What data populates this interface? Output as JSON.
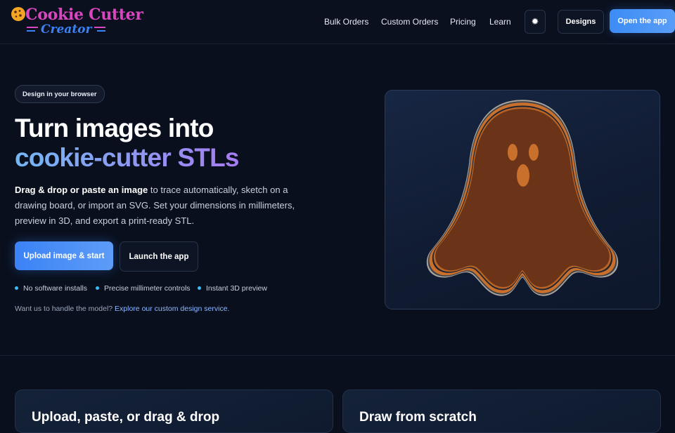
{
  "brand": {
    "line1": "Cookie Cutter",
    "line2": "Creator"
  },
  "nav": {
    "links": [
      "Bulk Orders",
      "Custom Orders",
      "Pricing",
      "Learn"
    ],
    "designs_label": "Designs",
    "open_app_label": "Open the app"
  },
  "hero": {
    "badge": "Design in your browser",
    "title_line1": "Turn images into",
    "title_line2": "cookie-cutter STLs",
    "lead_bold": "Drag & drop or paste an image",
    "lead_rest": " to trace automatically, sketch on a drawing board, or import an SVG. Set your dimensions in millimeters, preview in 3D, and export a print-ready STL.",
    "upload_label": "Upload image & start",
    "launch_label": "Launch the app",
    "features": [
      "No software installs",
      "Precise millimeter controls",
      "Instant 3D preview"
    ],
    "service_prefix": "Want us to handle the model? ",
    "service_link": "Explore our custom design service."
  },
  "cards": [
    {
      "title": "Upload, paste, or drag & drop"
    },
    {
      "title": "Draw from scratch"
    }
  ],
  "colors": {
    "background": "#090f1c",
    "accent_blue": "#3b82f6",
    "logo_gold": "#f5a524",
    "logo_magenta": "#d946c0",
    "feature_dot": "#38bdf8",
    "cookie_brown": "#6b3419",
    "cookie_orange": "#c9702c"
  }
}
